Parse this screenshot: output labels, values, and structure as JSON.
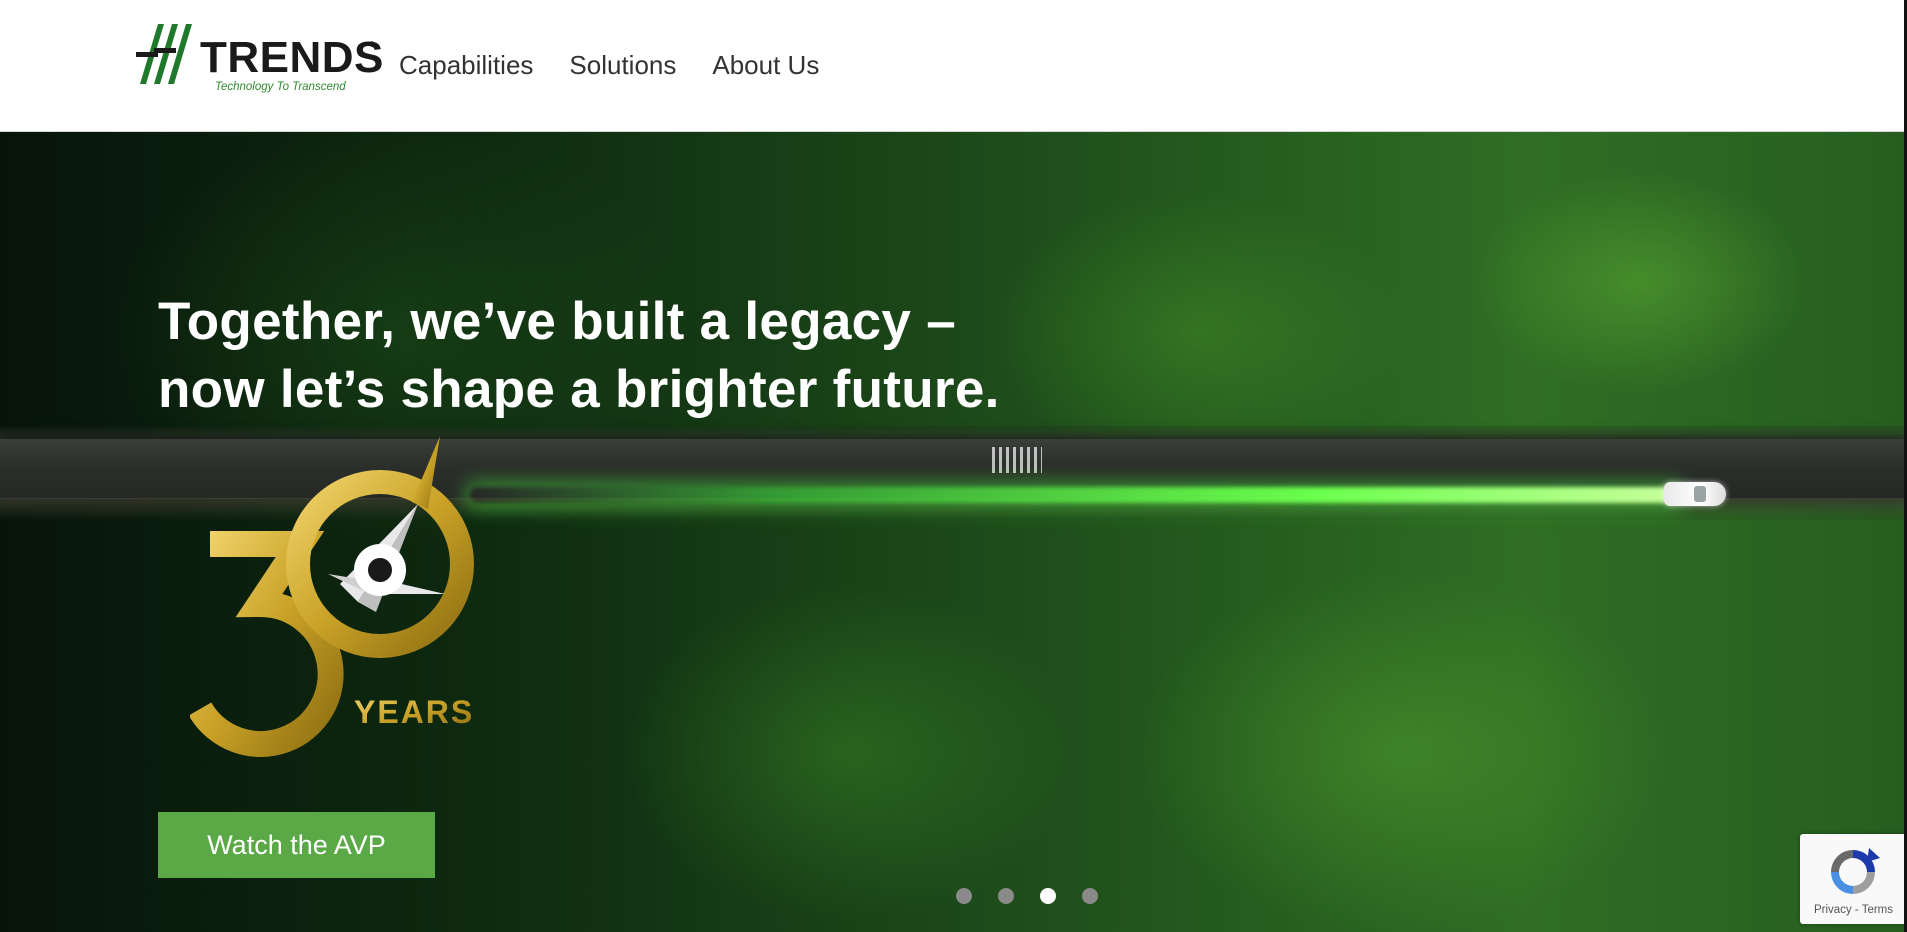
{
  "header": {
    "logo": {
      "wordmark": "TRENDS",
      "registered": "®",
      "tagline": "Technology To Transcend"
    },
    "nav": [
      {
        "label": "Capabilities"
      },
      {
        "label": "Solutions"
      },
      {
        "label": "About Us"
      }
    ]
  },
  "hero": {
    "headline_line1": "Together, we’ve built a legacy –",
    "headline_line2": "now let’s shape a brighter future.",
    "badge": {
      "text": "YEARS",
      "number": "30",
      "icon": "compass-icon"
    },
    "cta_label": "Watch the AVP",
    "carousel": {
      "slide_count": 4,
      "active_index": 2
    }
  },
  "recaptcha": {
    "privacy": "Privacy",
    "separator": " - ",
    "terms": "Terms"
  },
  "colors": {
    "accent_green": "#5aa946",
    "tagline_green": "#2e8b2e",
    "gold": "#c9a227",
    "nav_text": "#333333"
  }
}
